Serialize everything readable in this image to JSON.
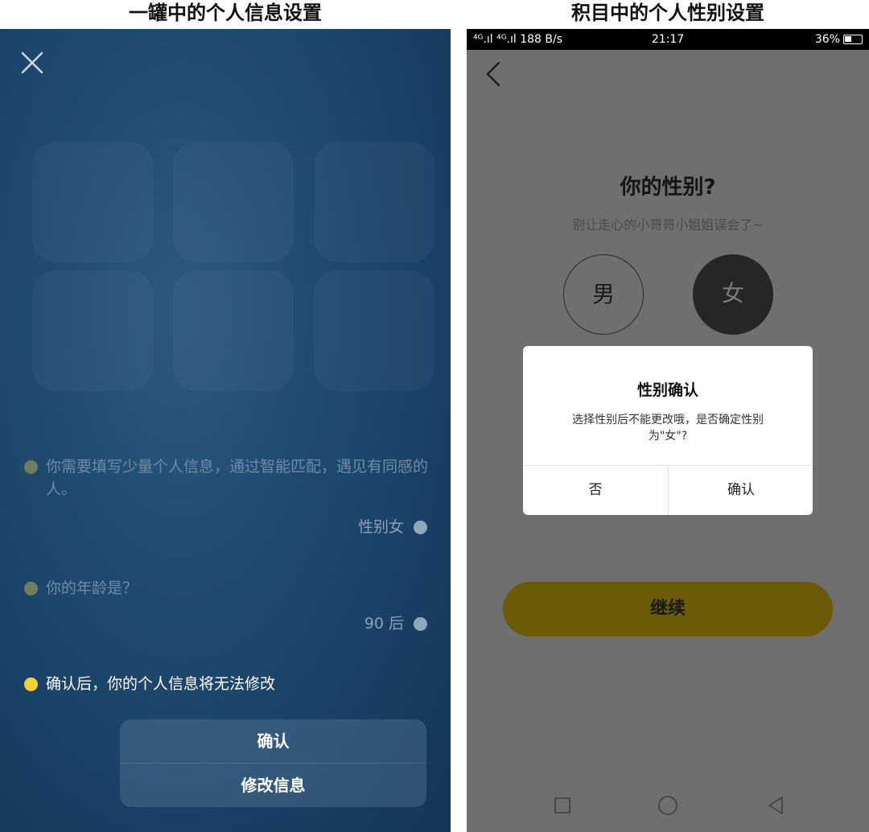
{
  "captions": {
    "left": "一罐中的个人信息设置",
    "right": "积目中的个人性别设置"
  },
  "left_app": {
    "messages": [
      "你需要填写少量个人信息，通过智能匹配，遇见有同感的人。",
      "你的年龄是？",
      "确认后，你的个人信息将无法修改"
    ],
    "replies": [
      "性别女",
      "90 后"
    ],
    "confirm_label": "确认",
    "modify_label": "修改信息",
    "colors": {
      "highlight_bullet": "#f5d233",
      "background": "#1f4a70"
    }
  },
  "right_app": {
    "status_bar": {
      "left": "⁴ᴳ.ıl ⁴ᴳ.ıl  188 B/s",
      "time": "21:17",
      "right": "36%"
    },
    "title": "你的性别?",
    "subtitle": "别让走心的小哥哥小姐姐误会了~",
    "gender_male": "男",
    "gender_female": "女",
    "dialog": {
      "title": "性别确认",
      "body": "选择性别后不能更改哦，是否确定性别为\"女\"?",
      "no_label": "否",
      "yes_label": "确认"
    },
    "continue_label": "继续",
    "colors": {
      "continue_button": "#6b5a06"
    }
  }
}
